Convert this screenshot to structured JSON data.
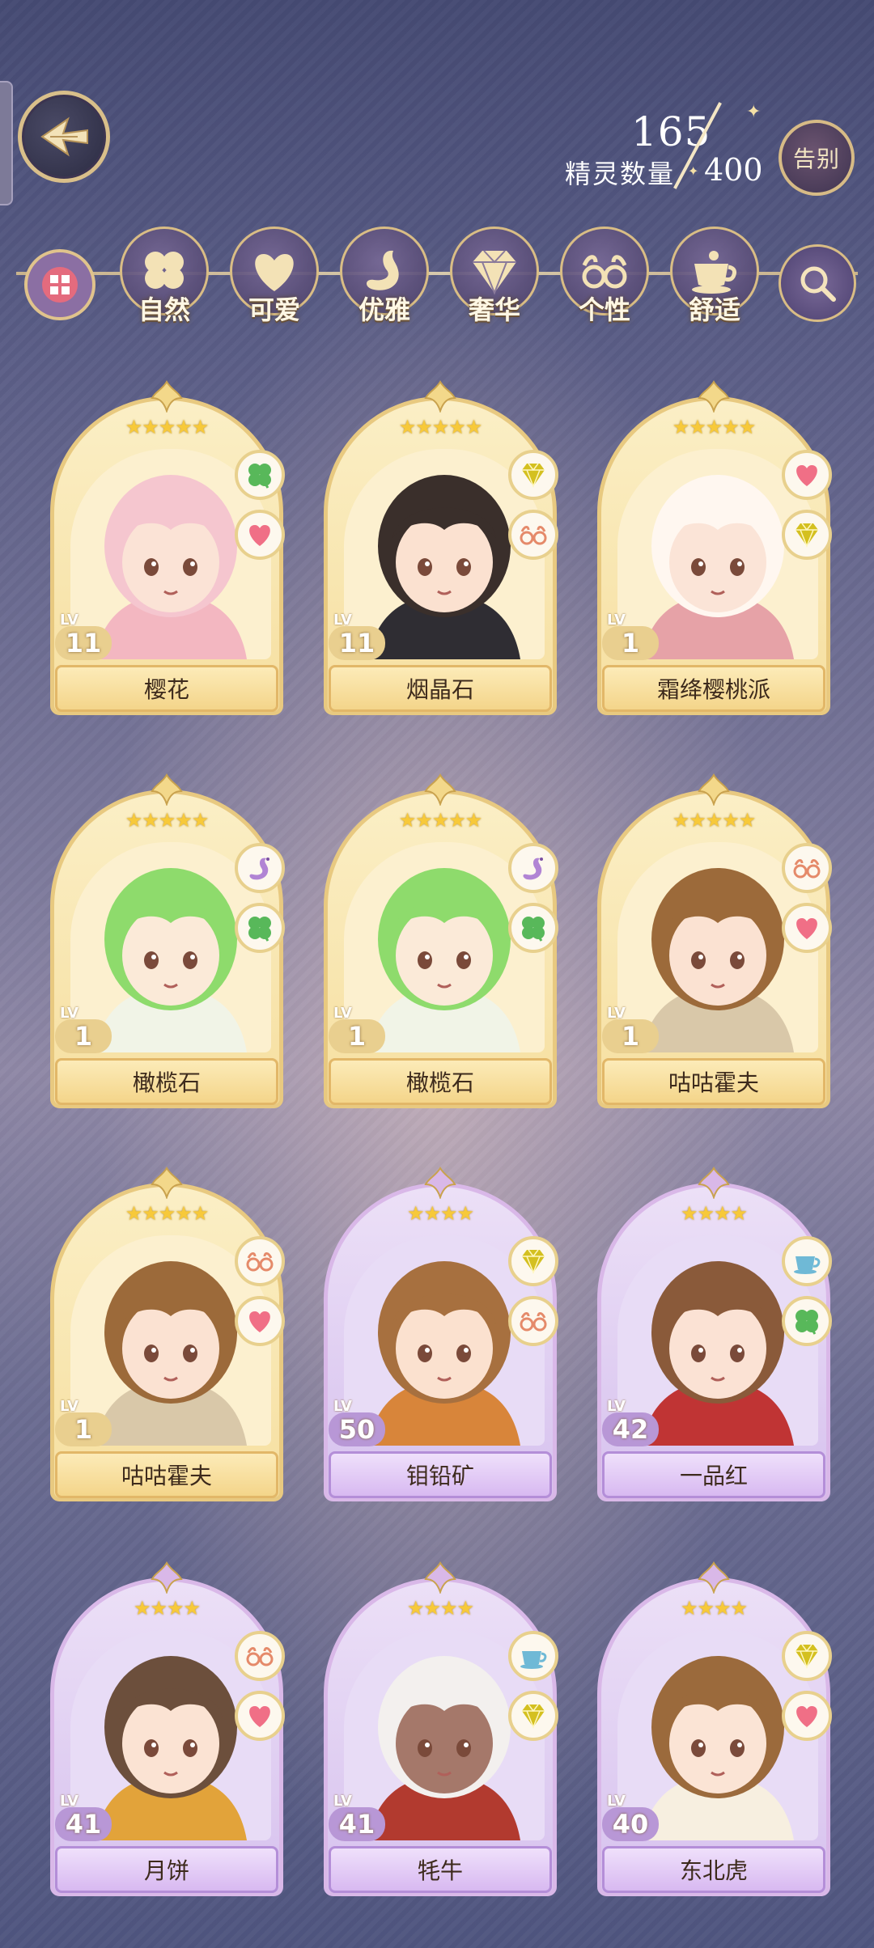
{
  "header": {
    "count_current": "165",
    "count_label": "精灵数量",
    "count_max": "400",
    "farewell_label": "告别"
  },
  "filters": [
    {
      "label": "自然",
      "icon": "clover-icon"
    },
    {
      "label": "可爱",
      "icon": "heart-icon"
    },
    {
      "label": "优雅",
      "icon": "swan-icon"
    },
    {
      "label": "奢华",
      "icon": "diamond-icon"
    },
    {
      "label": "个性",
      "icon": "glasses-icon"
    },
    {
      "label": "舒适",
      "icon": "teacup-icon"
    }
  ],
  "level_tag": "LV",
  "cards": [
    {
      "name": "樱花",
      "level": "11",
      "stars": 5,
      "theme": "gold",
      "badges": [
        "clover-icon",
        "heart-icon"
      ],
      "hair": "#f5c6cf",
      "skin": "#fbe3d6",
      "outfit": "#f3b7c1"
    },
    {
      "name": "烟晶石",
      "level": "11",
      "stars": 5,
      "theme": "gold",
      "badges": [
        "diamond-icon",
        "glasses-icon"
      ],
      "hair": "#3a2f2b",
      "skin": "#fbe1d0",
      "outfit": "#2f2d33"
    },
    {
      "name": "霜绛樱桃派",
      "level": "1",
      "stars": 5,
      "theme": "gold",
      "badges": [
        "heart-icon",
        "diamond-icon"
      ],
      "hair": "#fff7f0",
      "skin": "#fbe4d7",
      "outfit": "#e6a2a7"
    },
    {
      "name": "橄榄石",
      "level": "1",
      "stars": 5,
      "theme": "gold",
      "badges": [
        "swan-icon",
        "clover-icon"
      ],
      "hair": "#8edb6c",
      "skin": "#fbead8",
      "outfit": "#f1f4e7"
    },
    {
      "name": "橄榄石",
      "level": "1",
      "stars": 5,
      "theme": "gold",
      "badges": [
        "swan-icon",
        "clover-icon"
      ],
      "hair": "#8edb6c",
      "skin": "#fbead8",
      "outfit": "#f1f4e7"
    },
    {
      "name": "咕咕霍夫",
      "level": "1",
      "stars": 5,
      "theme": "gold",
      "badges": [
        "glasses-icon",
        "heart-icon"
      ],
      "hair": "#9c6a3a",
      "skin": "#fbe2d2",
      "outfit": "#d9c8a9"
    },
    {
      "name": "咕咕霍夫",
      "level": "1",
      "stars": 5,
      "theme": "gold",
      "badges": [
        "glasses-icon",
        "heart-icon"
      ],
      "hair": "#9c6a3a",
      "skin": "#fbe2d2",
      "outfit": "#d9c8a9"
    },
    {
      "name": "钼铅矿",
      "level": "50",
      "stars": 4,
      "theme": "purple",
      "badges": [
        "diamond-icon",
        "glasses-icon"
      ],
      "hair": "#a7703f",
      "skin": "#fbe1cf",
      "outfit": "#d8853a"
    },
    {
      "name": "一品红",
      "level": "42",
      "stars": 4,
      "theme": "purple",
      "badges": [
        "teacup-icon",
        "clover-icon"
      ],
      "hair": "#8a5a3a",
      "skin": "#fbe2d4",
      "outfit": "#c03434"
    },
    {
      "name": "月饼",
      "level": "41",
      "stars": 4,
      "theme": "purple",
      "badges": [
        "glasses-icon",
        "heart-icon"
      ],
      "hair": "#6c4f3c",
      "skin": "#fbe3d3",
      "outfit": "#e2a33a"
    },
    {
      "name": "牦牛",
      "level": "41",
      "stars": 4,
      "theme": "purple",
      "badges": [
        "teacup-icon",
        "diamond-icon"
      ],
      "hair": "#f3f0ee",
      "skin": "#a5786a",
      "outfit": "#b23a2f"
    },
    {
      "name": "东北虎",
      "level": "40",
      "stars": 4,
      "theme": "purple",
      "badges": [
        "diamond-icon",
        "heart-icon"
      ],
      "hair": "#9b6a3c",
      "skin": "#fbe4d5",
      "outfit": "#f7efe0"
    }
  ],
  "colors": {
    "gold_frame": "#e8c980",
    "purple_frame": "#d9b8e8",
    "star": "#f7c93a",
    "clover": "#58b85a",
    "heart": "#f06f86",
    "diamond": "#d4c020",
    "glasses": "#e58a6a",
    "teacup": "#6fb9d6",
    "swan": "#b184d4"
  }
}
